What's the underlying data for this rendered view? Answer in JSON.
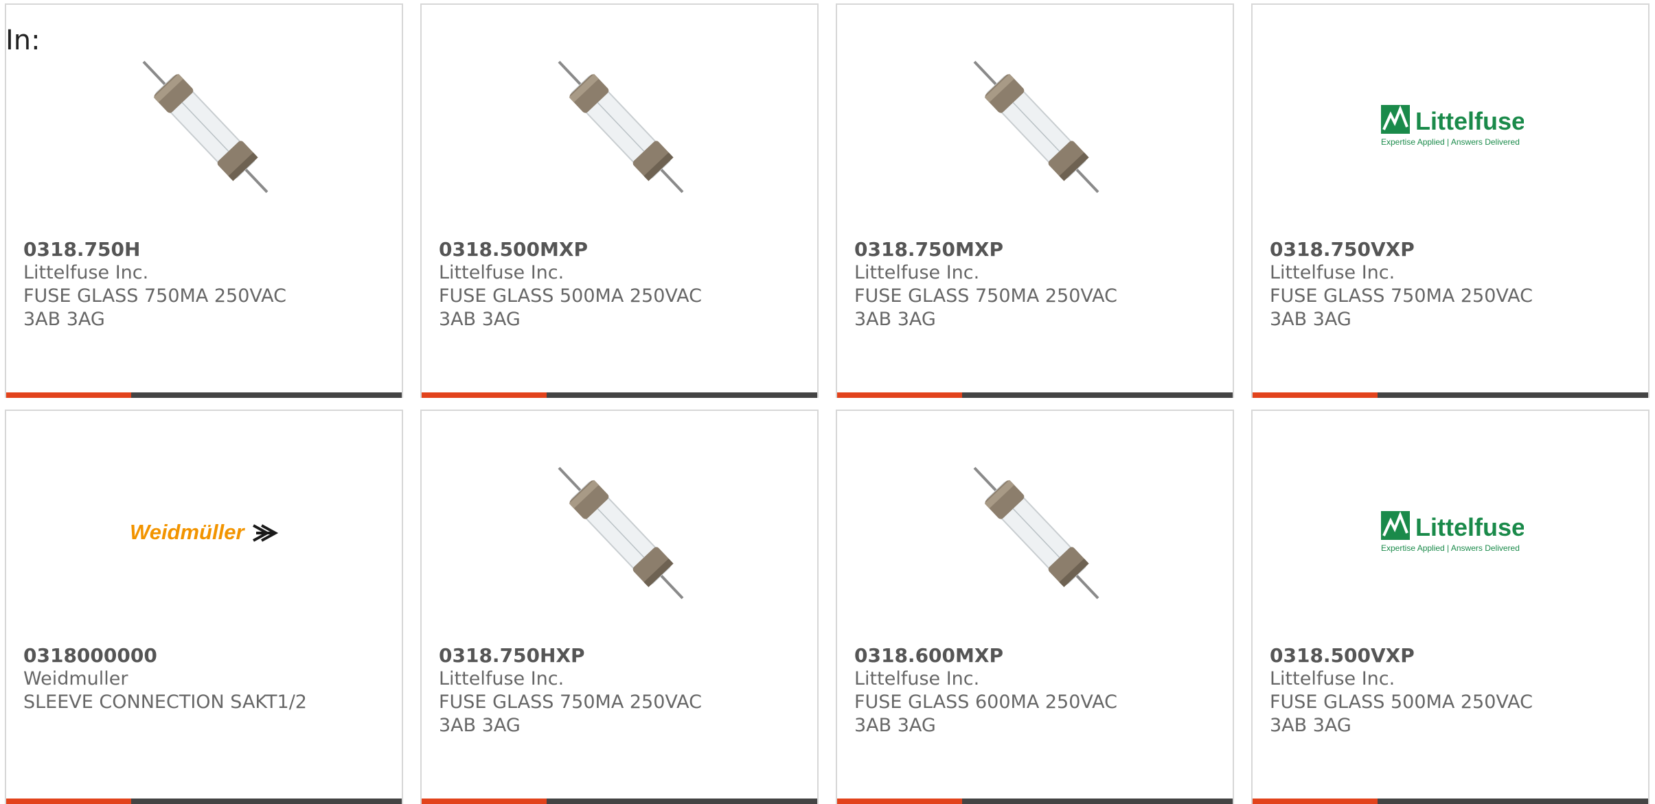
{
  "page": {
    "heading": "In:"
  },
  "products": [
    {
      "part_number": "0318.750H",
      "manufacturer": "Littelfuse Inc.",
      "description": "FUSE GLASS 750MA 250VAC 3AB 3AG",
      "image": "fuse-icon"
    },
    {
      "part_number": "0318.500MXP",
      "manufacturer": "Littelfuse Inc.",
      "description": "FUSE GLASS 500MA 250VAC 3AB 3AG",
      "image": "fuse-icon"
    },
    {
      "part_number": "0318.750MXP",
      "manufacturer": "Littelfuse Inc.",
      "description": "FUSE GLASS 750MA 250VAC 3AB 3AG",
      "image": "fuse-icon"
    },
    {
      "part_number": "0318.750VXP",
      "manufacturer": "Littelfuse Inc.",
      "description": "FUSE GLASS 750MA 250VAC 3AB 3AG",
      "image": "littelfuse-logo",
      "logo_text": "Littelfuse",
      "logo_tagline": "Expertise Applied | Answers Delivered"
    },
    {
      "part_number": "0318000000",
      "manufacturer": "Weidmuller",
      "description": "SLEEVE CONNECTION SAKT1/2",
      "image": "weidmuller-logo",
      "logo_text": "Weidmüller"
    },
    {
      "part_number": "0318.750HXP",
      "manufacturer": "Littelfuse Inc.",
      "description": "FUSE GLASS 750MA 250VAC 3AB 3AG",
      "image": "fuse-icon"
    },
    {
      "part_number": "0318.600MXP",
      "manufacturer": "Littelfuse Inc.",
      "description": "FUSE GLASS 600MA 250VAC 3AB 3AG",
      "image": "fuse-icon"
    },
    {
      "part_number": "0318.500VXP",
      "manufacturer": "Littelfuse Inc.",
      "description": "FUSE GLASS 500MA 250VAC 3AB 3AG",
      "image": "littelfuse-logo",
      "logo_text": "Littelfuse",
      "logo_tagline": "Expertise Applied | Answers Delivered"
    }
  ],
  "colors": {
    "accent": "#e2431c",
    "bar": "#444444",
    "littelfuse_green": "#1a8a4a",
    "weidmuller_orange": "#f29400"
  }
}
